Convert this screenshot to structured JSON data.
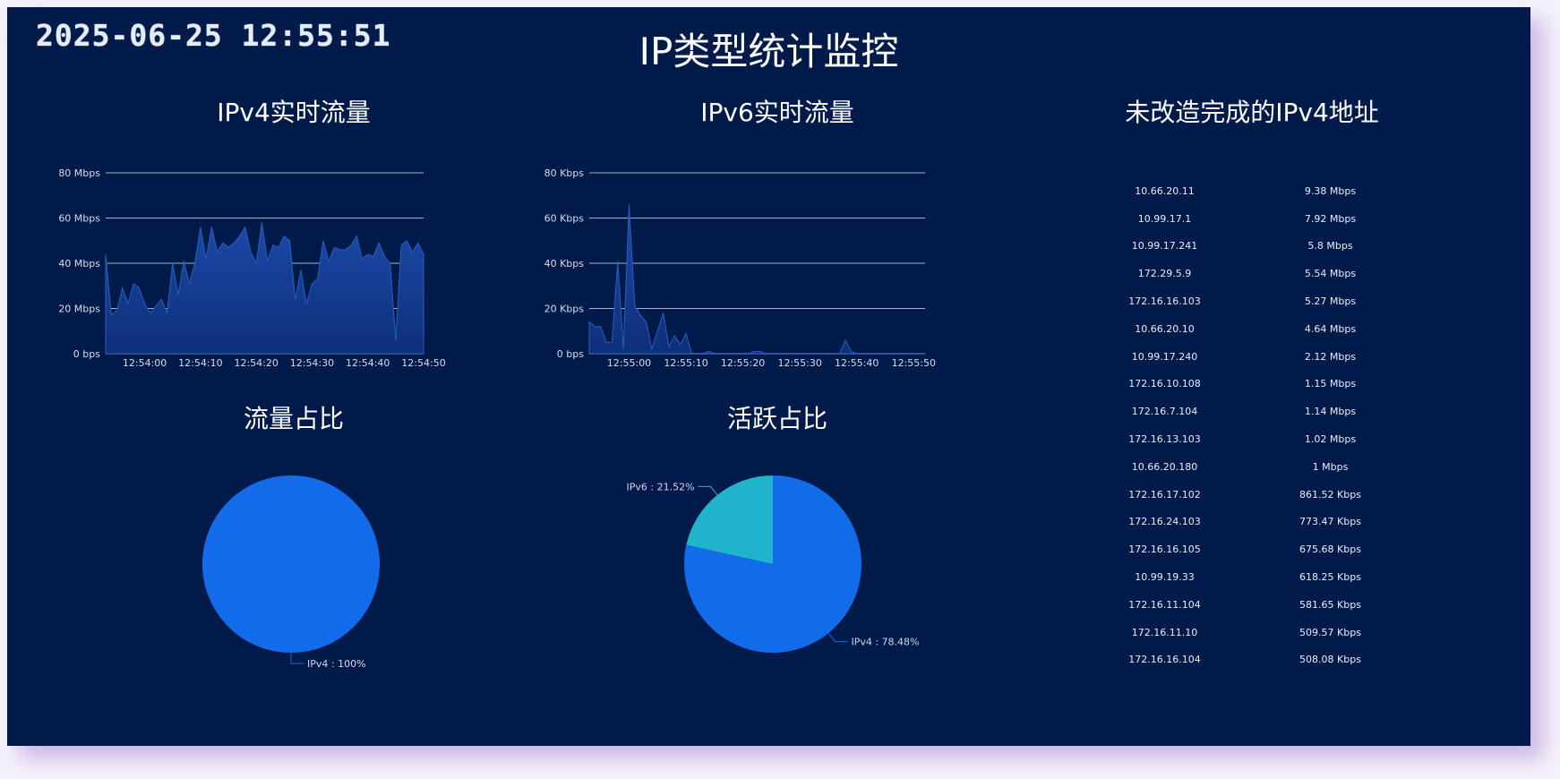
{
  "header": {
    "clock": "2025-06-25 12:55:51",
    "title": "IP类型统计监控"
  },
  "panels": {
    "ipv4_traffic_title": "IPv4实时流量",
    "ipv6_traffic_title": "IPv6实时流量",
    "ipv4_unfinished_title": "未改造完成的IPv4地址",
    "traffic_share_title": "流量占比",
    "active_share_title": "活跃占比"
  },
  "colors": {
    "background": "#001a49",
    "area_fill": "#1a4aa8",
    "pie_ipv4": "#126be8",
    "pie_ipv6": "#1fb4cb"
  },
  "chart_data": [
    {
      "type": "area",
      "title": "IPv4实时流量",
      "y_unit": "Mbps",
      "ylim": [
        0,
        80
      ],
      "y_ticks": [
        "0 bps",
        "20 Mbps",
        "40 Mbps",
        "60 Mbps",
        "80 Mbps"
      ],
      "y_tick_values": [
        0,
        20,
        40,
        60,
        80
      ],
      "x_ticks": [
        "12:54:00",
        "12:54:10",
        "12:54:20",
        "12:54:30",
        "12:54:40",
        "12:54:50"
      ],
      "x_tick_values": [
        0,
        10,
        20,
        30,
        40,
        50
      ],
      "xlim": [
        -7,
        50
      ],
      "grid": true,
      "series": [
        {
          "x": [
            -7,
            -6,
            -5,
            -4,
            -3,
            -2,
            -1,
            0,
            1,
            2,
            3,
            4,
            5,
            6,
            7,
            8,
            9,
            10,
            11,
            12,
            13,
            14,
            15,
            16,
            17,
            18,
            19,
            20,
            21,
            22,
            23,
            24,
            25,
            26,
            27,
            28,
            29,
            30,
            31,
            32,
            33,
            34,
            35,
            36,
            37,
            38,
            39,
            40,
            41,
            42,
            43,
            44,
            45,
            46,
            47,
            48,
            49,
            50
          ],
          "values": [
            44,
            17,
            19,
            29,
            22,
            31,
            29,
            22,
            18,
            21,
            24,
            18,
            40,
            26,
            41,
            31,
            40,
            56,
            42,
            56,
            45,
            49,
            47,
            49,
            52,
            56,
            45,
            40,
            58,
            41,
            48,
            47,
            52,
            50,
            24,
            37,
            22,
            31,
            33,
            50,
            41,
            47,
            46,
            46,
            48,
            52,
            42,
            44,
            43,
            49,
            43,
            40,
            6,
            48,
            50,
            45,
            49,
            44
          ]
        }
      ]
    },
    {
      "type": "area",
      "title": "IPv6实时流量",
      "y_unit": "Kbps",
      "ylim": [
        0,
        80
      ],
      "y_ticks": [
        "0 bps",
        "20 Kbps",
        "40 Kbps",
        "60 Kbps",
        "80 Kbps"
      ],
      "y_tick_values": [
        0,
        20,
        40,
        60,
        80
      ],
      "x_ticks": [
        "12:55:00",
        "12:55:10",
        "12:55:20",
        "12:55:30",
        "12:55:40",
        "12:55:50"
      ],
      "x_tick_values": [
        0,
        10,
        20,
        30,
        40,
        50
      ],
      "xlim": [
        -7,
        52
      ],
      "grid": true,
      "series": [
        {
          "x": [
            -7,
            -6,
            -5,
            -4,
            -3,
            -2,
            -1,
            0,
            1,
            2,
            3,
            4,
            5,
            6,
            7,
            8,
            9,
            10,
            11,
            12,
            13,
            14,
            15,
            16,
            17,
            18,
            19,
            20,
            21,
            22,
            23,
            24,
            25,
            26,
            27,
            28,
            29,
            30,
            31,
            32,
            33,
            34,
            35,
            36,
            37,
            38,
            39,
            40,
            41,
            42,
            43,
            44,
            45,
            46,
            47,
            48,
            49,
            50,
            51,
            52
          ],
          "values": [
            14,
            12,
            12,
            5,
            5,
            41,
            2,
            66,
            21,
            17,
            14,
            2,
            10,
            18,
            3,
            8,
            4,
            9,
            0,
            0,
            0,
            1,
            0,
            0,
            0,
            0,
            0,
            0,
            0,
            1,
            1,
            0,
            0,
            0,
            0,
            0,
            0,
            0,
            0,
            0,
            0,
            0,
            0,
            0,
            0,
            6,
            1,
            0,
            0,
            0,
            0,
            0,
            0,
            0,
            0,
            0,
            0,
            0,
            0,
            0
          ]
        }
      ]
    },
    {
      "type": "pie",
      "title": "流量占比",
      "slices": [
        {
          "name": "IPv4",
          "value": 100,
          "label": "IPv4 : 100%"
        }
      ]
    },
    {
      "type": "pie",
      "title": "活跃占比",
      "slices": [
        {
          "name": "IPv4",
          "value": 78.48,
          "label": "IPv4 : 78.48%"
        },
        {
          "name": "IPv6",
          "value": 21.52,
          "label": "IPv6 : 21.52%"
        }
      ]
    },
    {
      "type": "table",
      "title": "未改造完成的IPv4地址",
      "rows": [
        {
          "ip": "10.66.20.11",
          "rate": "9.38 Mbps"
        },
        {
          "ip": "10.99.17.1",
          "rate": "7.92 Mbps"
        },
        {
          "ip": "10.99.17.241",
          "rate": "5.8 Mbps"
        },
        {
          "ip": "172.29.5.9",
          "rate": "5.54 Mbps"
        },
        {
          "ip": "172.16.16.103",
          "rate": "5.27 Mbps"
        },
        {
          "ip": "10.66.20.10",
          "rate": "4.64 Mbps"
        },
        {
          "ip": "10.99.17.240",
          "rate": "2.12 Mbps"
        },
        {
          "ip": "172.16.10.108",
          "rate": "1.15 Mbps"
        },
        {
          "ip": "172.16.7.104",
          "rate": "1.14 Mbps"
        },
        {
          "ip": "172.16.13.103",
          "rate": "1.02 Mbps"
        },
        {
          "ip": "10.66.20.180",
          "rate": "1 Mbps"
        },
        {
          "ip": "172.16.17.102",
          "rate": "861.52 Kbps"
        },
        {
          "ip": "172.16.24.103",
          "rate": "773.47 Kbps"
        },
        {
          "ip": "172.16.16.105",
          "rate": "675.68 Kbps"
        },
        {
          "ip": "10.99.19.33",
          "rate": "618.25 Kbps"
        },
        {
          "ip": "172.16.11.104",
          "rate": "581.65 Kbps"
        },
        {
          "ip": "172.16.11.10",
          "rate": "509.57 Kbps"
        },
        {
          "ip": "172.16.16.104",
          "rate": "508.08 Kbps"
        }
      ]
    }
  ]
}
